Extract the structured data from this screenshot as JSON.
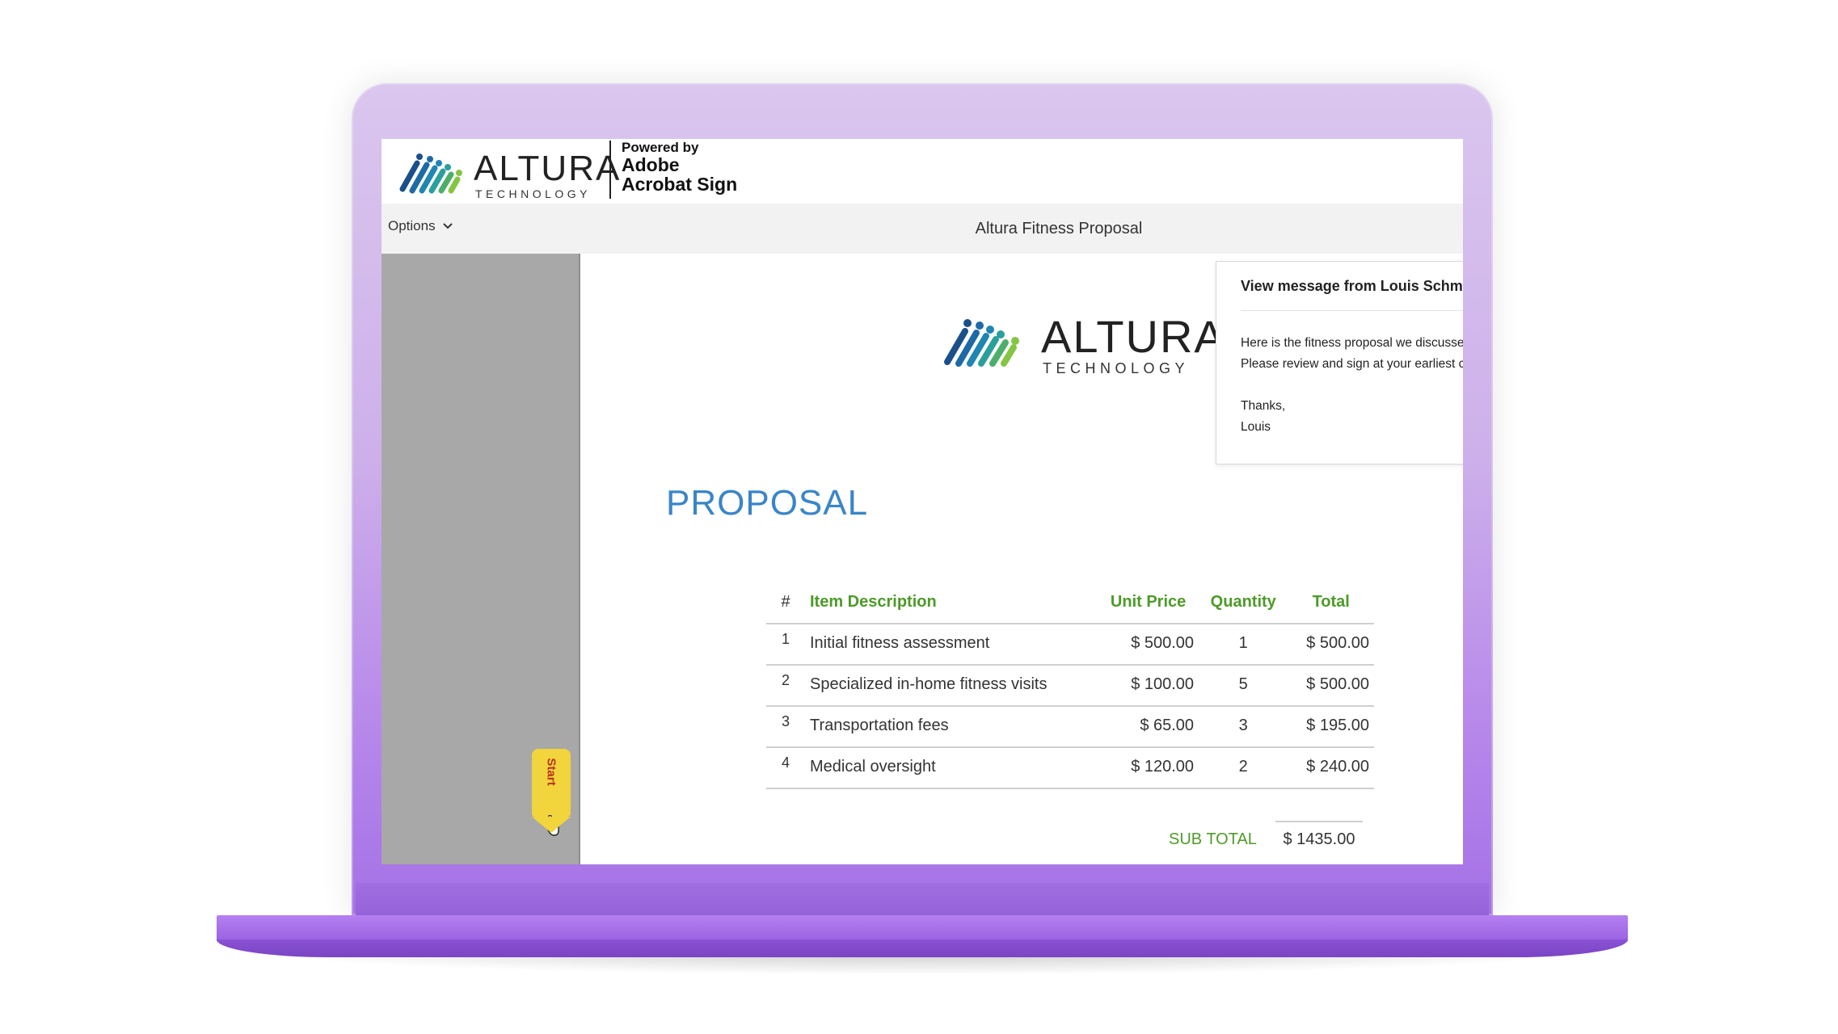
{
  "brand": {
    "name": "ALTURA",
    "tagline": "TECHNOLOGY",
    "powered_by": "Powered by",
    "adobe_line1": "Adobe",
    "adobe_line2": "Acrobat Sign"
  },
  "toolbar": {
    "options_label": "Options",
    "document_title": "Altura Fitness Proposal"
  },
  "sidebar": {
    "start_label": "Start"
  },
  "message": {
    "title": "View message from Louis Schmidt",
    "line1": "Here is the fitness proposal we discussed",
    "line2": "Please review and sign at your earliest co",
    "closing": "Thanks,",
    "signature": "Louis"
  },
  "document": {
    "heading": "PROPOSAL",
    "columns": {
      "num": "#",
      "description": "Item Description",
      "unit_price": "Unit Price",
      "quantity": "Quantity",
      "total": "Total"
    },
    "rows": [
      {
        "num": "1",
        "description": "Initial fitness assessment",
        "unit_price": "$ 500.00",
        "quantity": "1",
        "total": "$ 500.00"
      },
      {
        "num": "2",
        "description": "Specialized in-home fitness visits",
        "unit_price": "$ 100.00",
        "quantity": "5",
        "total": "$ 500.00"
      },
      {
        "num": "3",
        "description": "Transportation fees",
        "unit_price": "$ 65.00",
        "quantity": "3",
        "total": "$ 195.00"
      },
      {
        "num": "4",
        "description": "Medical oversight",
        "unit_price": "$ 120.00",
        "quantity": "2",
        "total": "$ 240.00"
      }
    ],
    "subtotal_label": "SUB TOTAL",
    "subtotal_value": "$ 1435.00"
  },
  "colors": {
    "accent_blue": "#3a85c8",
    "accent_green": "#4d9a28",
    "start_tag": "#f2d43c",
    "laptop_purple": "#b585ea"
  },
  "icons": {
    "options": "chevron-down-icon",
    "start_cursor": "hand-pointer-icon",
    "logo": "altura-logo"
  }
}
